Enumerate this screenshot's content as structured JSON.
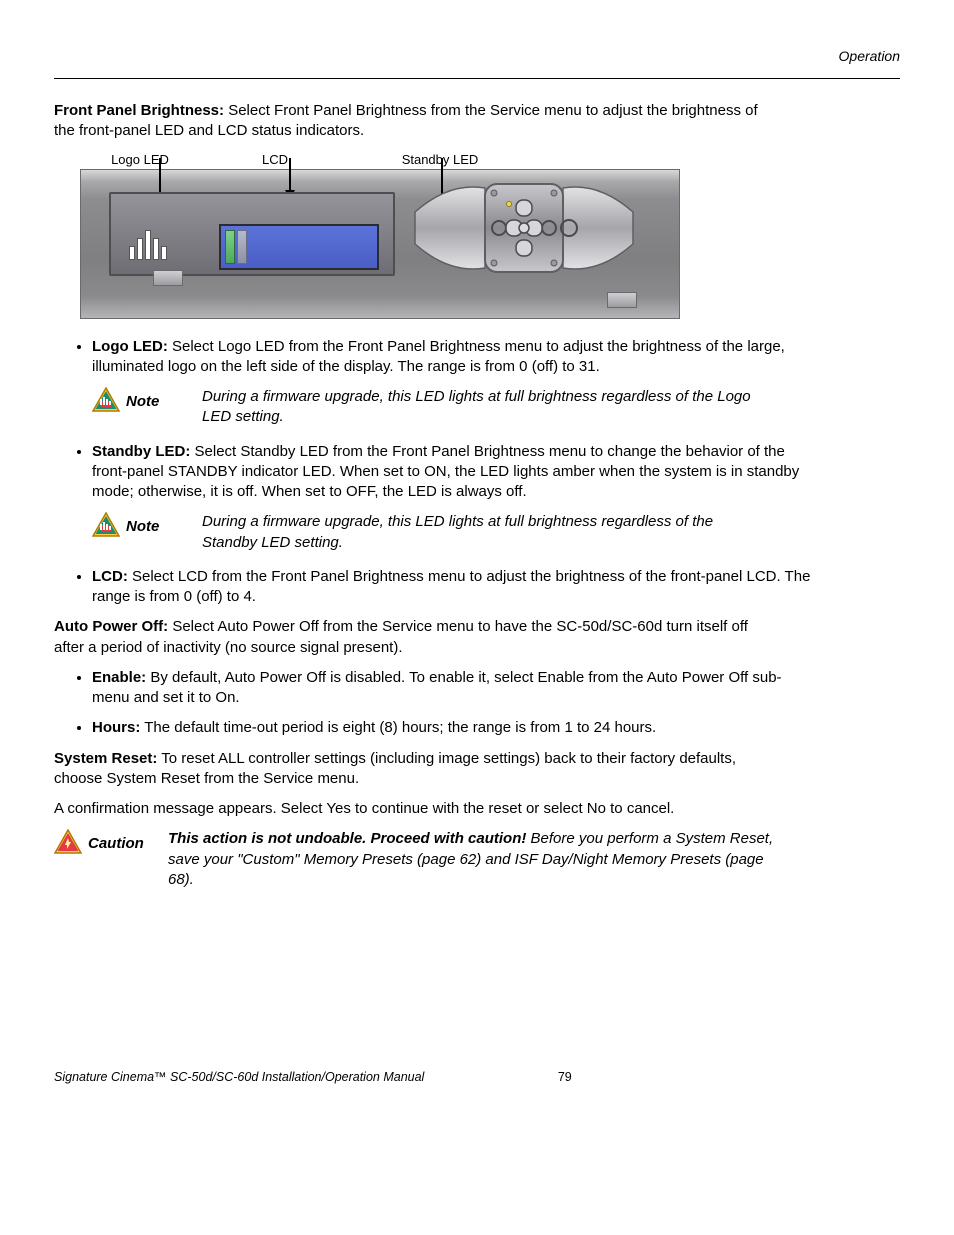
{
  "header": {
    "section": "Operation"
  },
  "fpb": {
    "heading": "Front Panel Brightness:",
    "text": " Select Front Panel Brightness from the Service menu to adjust the brightness of the front-panel LED and LCD status indicators."
  },
  "diagram": {
    "label_logo": "Logo LED",
    "label_lcd": "LCD",
    "label_standby": "Standby LED"
  },
  "logo_led": {
    "heading": "Logo LED:",
    "text": " Select Logo LED from the Front Panel Brightness menu to adjust the brightness of the large, illuminated logo on the left side of the display. The range is from 0 (off) to 31."
  },
  "note1": {
    "label": "Note",
    "text": "During a firmware upgrade, this LED lights at full brightness regardless of the Logo LED setting."
  },
  "standby_led": {
    "heading": "Standby LED:",
    "text": " Select Standby LED from the Front Panel Brightness menu to change the behavior of the front-panel STANDBY indicator LED. When set to ON, the LED lights amber when the system is in standby mode; otherwise, it is off. When set to OFF, the LED is always off."
  },
  "note2": {
    "label": "Note",
    "text": "During a firmware upgrade, this LED lights at full brightness regardless of the Standby LED setting."
  },
  "lcd": {
    "heading": "LCD:",
    "text": " Select LCD from the Front Panel Brightness menu to adjust the brightness of the front-panel LCD. The range is from 0 (off) to 4."
  },
  "apo": {
    "heading": "Auto Power Off:",
    "text": " Select Auto Power Off from the Service menu to have the SC-50d/SC-60d turn itself off after a period of inactivity (no source signal present)."
  },
  "apo_enable": {
    "heading": "Enable:",
    "text": " By default, Auto Power Off is disabled. To enable it, select Enable from the Auto Power Off sub-menu and set it to On."
  },
  "apo_hours": {
    "heading": "Hours:",
    "text": " The default time-out period is eight (8) hours; the range is from 1 to 24 hours."
  },
  "sysreset": {
    "heading": "System Reset:",
    "text": " To reset ALL controller settings (including image settings) back to their factory defaults, choose System Reset from the Service menu."
  },
  "sysreset_confirm": "A confirmation message appears. Select Yes to continue with the reset or select No to cancel.",
  "caution": {
    "label": "Caution",
    "strong": "This action is not undoable. Proceed with caution!",
    "rest": " Before you perform a System Reset, save your \"Custom\" Memory Presets (page 62) and ISF Day/Night Memory Presets (page 68)."
  },
  "footer": {
    "title": "Signature Cinema™ SC-50d/SC-60d Installation/Operation Manual",
    "page": "79"
  }
}
